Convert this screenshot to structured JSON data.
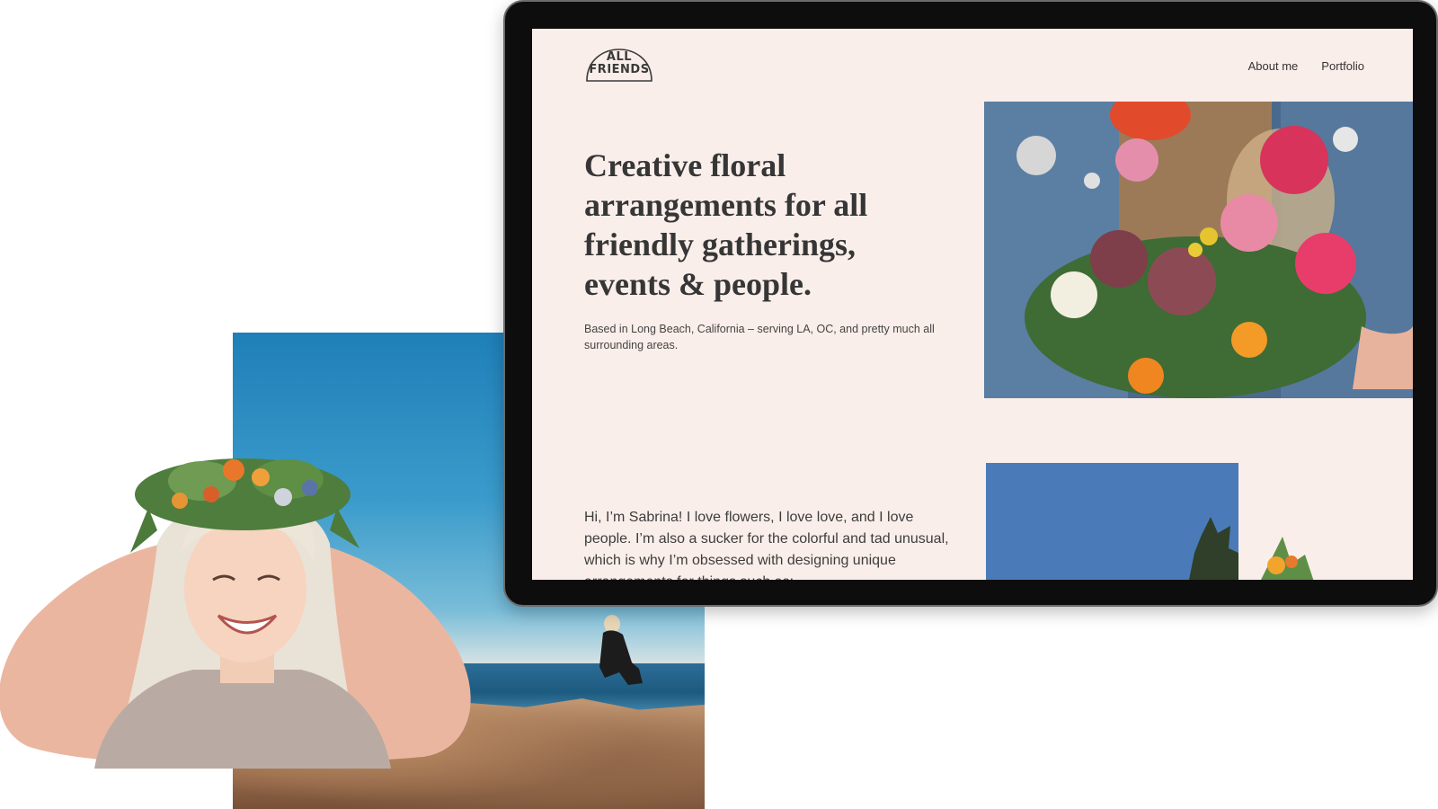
{
  "site": {
    "logo": {
      "line1": "ALL",
      "line2": "FRIENDS"
    },
    "nav": [
      {
        "label": "About me"
      },
      {
        "label": "Portfolio"
      }
    ],
    "hero": {
      "title": "Creative floral arrangements for all friendly gatherings, events & people.",
      "subtitle": "Based in Long Beach, California – serving LA, OC, and pretty much all surrounding areas."
    },
    "bio": {
      "text": "Hi, I’m Sabrina! I love flowers, I love love, and I love people. I’m also a sucker for the colorful and tad unusual, which is why I’m obsessed with designing unique arrangements for things such as:"
    }
  },
  "colors": {
    "page_bg": "#faeeea",
    "blob": "#ebb6a0",
    "monitor_frame": "#0d0d0d",
    "text_dark": "#363636"
  }
}
